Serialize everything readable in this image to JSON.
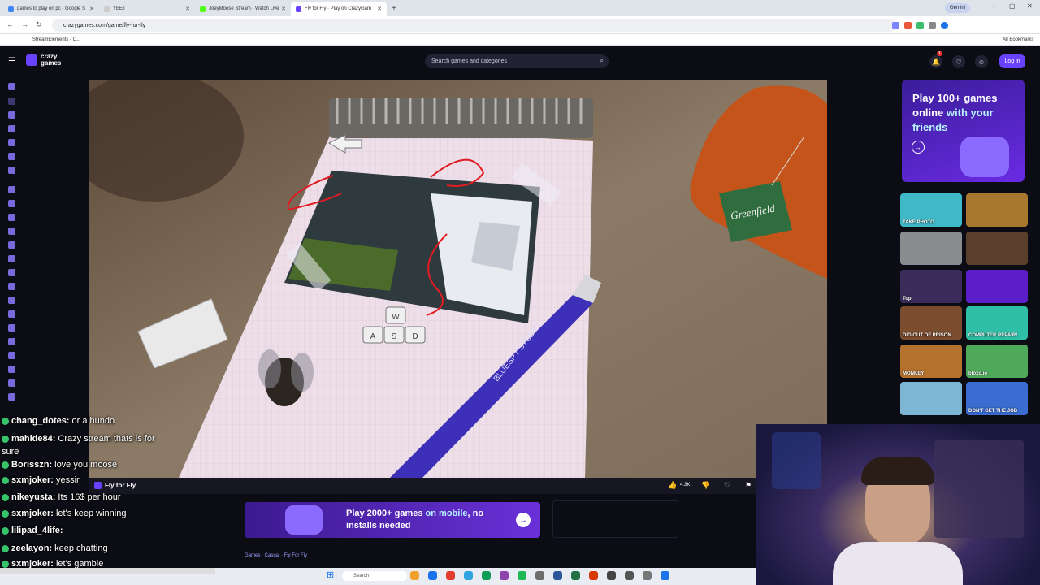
{
  "browser": {
    "tabs": [
      {
        "label": "games to play on pc - Google S",
        "favicon_color": "#4285f4"
      },
      {
        "label": "YEET",
        "favicon_color": "#e7e7e7"
      },
      {
        "label": "JoeyMoose Stream - Watch Live",
        "favicon_color": "#53fc18"
      },
      {
        "label": "Fly for Fly · Play on CrazyGam",
        "favicon_color": "#6842ff",
        "active": true
      }
    ],
    "gemini_label": "Gemini",
    "url": "crazygames.com/game/fly-for-fly",
    "bookmark": "StreamElements - O...",
    "all_bookmarks": "All Bookmarks"
  },
  "site": {
    "logo_line1": "crazy",
    "logo_line2": "games",
    "search_placeholder": "Search games and categories",
    "notification_count": "1",
    "login_label": "Log in",
    "game_title": "Fly for Fly",
    "like_count": "4.3K",
    "breadcrumb": "Games · Casual · Fly For Fly",
    "promo": {
      "line_a": "Play 100+ games",
      "line_b": "online ",
      "line_b_accent": "with your",
      "line_c_accent": "friends"
    },
    "mobile_banner": {
      "part1": "Play 2000+ games ",
      "part1_accent": "on mobile",
      "part2": ", no installs needed"
    },
    "rail_tiles": [
      {
        "label": "TAKE PHOTO",
        "color": "#3fb9c7"
      },
      {
        "label": "",
        "color": "#a8782e"
      },
      {
        "label": "",
        "color": "#8a8d90"
      },
      {
        "label": "",
        "color": "#5a3f2d"
      },
      {
        "label": "Top",
        "color": "#3a2b5a"
      },
      {
        "label": "",
        "color": "#5b1ec8"
      },
      {
        "label": "DIG OUT OF PRISON",
        "color": "#7b4c2d"
      },
      {
        "label": "COMPUTER REPAIR!",
        "color": "#2fbfa7"
      },
      {
        "label": "MONKEY",
        "color": "#b5712e"
      },
      {
        "label": "bloxd.io",
        "color": "#4fa95b"
      },
      {
        "label": "",
        "color": "#7db6d4"
      },
      {
        "label": "DON'T GET THE JOB",
        "color": "#3b6cd2"
      }
    ]
  },
  "game_scene": {
    "sign_text": "Greenfield",
    "pen_text": "BLUESPY STUDIO",
    "keys": [
      "W",
      "A",
      "S",
      "D"
    ]
  },
  "chat": [
    {
      "user": "chang_dotes:",
      "msg": "or a hundo"
    },
    {
      "user": "mahide84:",
      "msg": "Crazy stream thats is for"
    },
    {
      "user": "",
      "msg": "sure"
    },
    {
      "user": "Borisszn:",
      "msg": "love you moose"
    },
    {
      "user": "sxmjoker:",
      "msg": "yessir"
    },
    {
      "user": "nikeyusta:",
      "msg": "Its 16$ per hour"
    },
    {
      "user": "sxmjoker:",
      "msg": "let's keep winning"
    },
    {
      "user": "lilipad_4life:",
      "msg": ""
    },
    {
      "user": "zeelayon:",
      "msg": "keep chatting"
    },
    {
      "user": "sxmjoker:",
      "msg": "let's gamble"
    }
  ],
  "taskbar": {
    "search_label": "Search"
  }
}
